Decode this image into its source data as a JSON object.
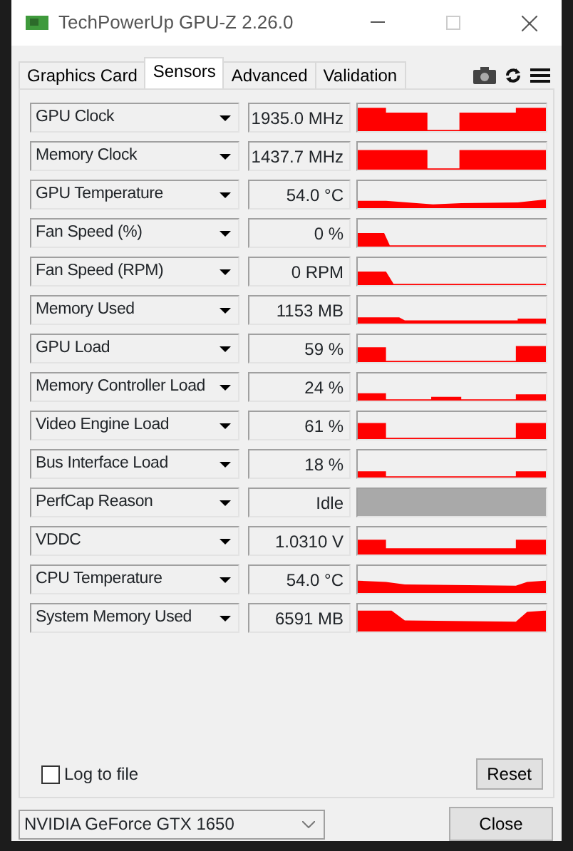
{
  "window": {
    "title": "TechPowerUp GPU-Z 2.26.0"
  },
  "tabs": [
    {
      "label": "Graphics Card",
      "selected": false
    },
    {
      "label": "Sensors",
      "selected": true
    },
    {
      "label": "Advanced",
      "selected": false
    },
    {
      "label": "Validation",
      "selected": false
    }
  ],
  "sensors": [
    {
      "name": "GPU Clock",
      "value": "1935.0 MHz",
      "kind": "graph"
    },
    {
      "name": "Memory Clock",
      "value": "1437.7 MHz",
      "kind": "graph"
    },
    {
      "name": "GPU Temperature",
      "value": "54.0 °C",
      "kind": "graph"
    },
    {
      "name": "Fan Speed (%)",
      "value": "0 %",
      "kind": "graph"
    },
    {
      "name": "Fan Speed (RPM)",
      "value": "0 RPM",
      "kind": "graph"
    },
    {
      "name": "Memory Used",
      "value": "1153 MB",
      "kind": "graph"
    },
    {
      "name": "GPU Load",
      "value": "59 %",
      "kind": "graph"
    },
    {
      "name": "Memory Controller Load",
      "value": "24 %",
      "kind": "graph"
    },
    {
      "name": "Video Engine Load",
      "value": "61 %",
      "kind": "graph"
    },
    {
      "name": "Bus Interface Load",
      "value": "18 %",
      "kind": "graph"
    },
    {
      "name": "PerfCap Reason",
      "value": "Idle",
      "kind": "status"
    },
    {
      "name": "VDDC",
      "value": "1.0310 V",
      "kind": "graph"
    },
    {
      "name": "CPU Temperature",
      "value": "54.0 °C",
      "kind": "graph"
    },
    {
      "name": "System Memory Used",
      "value": "6591 MB",
      "kind": "graph"
    }
  ],
  "log_to_file": {
    "label": "Log to file",
    "checked": false
  },
  "reset_button": "Reset",
  "device_select": {
    "value": "NVIDIA GeForce GTX 1650"
  },
  "close_button": "Close"
}
